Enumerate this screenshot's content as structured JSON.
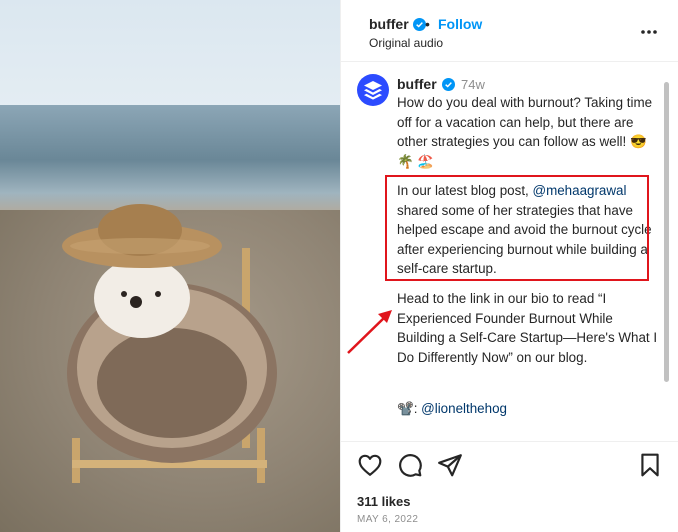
{
  "header": {
    "username": "buffer",
    "dot": "•",
    "follow_label": "Follow",
    "audio_label": "Original audio"
  },
  "caption": {
    "username": "buffer",
    "time": "74w",
    "paragraph1": "How do you deal with burnout? Taking time off for a vacation can help, but there are other strategies you can follow as well! 😎 🌴 🏖️",
    "paragraph2_prefix": "In our latest blog post, ",
    "paragraph2_mention": "@mehaagrawal",
    "paragraph2_suffix": " shared some of her strategies that have helped escape and avoid the burnout cycle after experiencing burnout while building a self-care startup.",
    "paragraph3": "Head to the link in our bio to read “I Experienced Founder Burnout While Building a Self-Care Startup—Here's What I Do Differently Now” on our blog.",
    "paragraph4_icon": "📽️",
    "paragraph4_prefix": ": ",
    "paragraph4_mention": "@lionelthehog"
  },
  "footer": {
    "likes": "311 likes",
    "date": "MAY 6, 2022"
  },
  "colors": {
    "accent": "#0095f6",
    "highlight": "#e0151c",
    "brand": "#2c4bff"
  },
  "icons": [
    "verified-badge-icon",
    "more-options-icon",
    "buffer-logo-icon",
    "heart-icon",
    "comment-icon",
    "share-icon",
    "bookmark-icon",
    "red-arrow-annotation"
  ]
}
